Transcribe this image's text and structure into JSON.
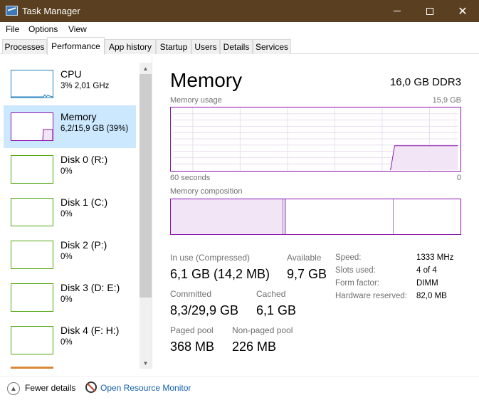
{
  "window": {
    "title": "Task Manager"
  },
  "menu": {
    "file": "File",
    "options": "Options",
    "view": "View"
  },
  "tabs": [
    "Processes",
    "Performance",
    "App history",
    "Startup",
    "Users",
    "Details",
    "Services"
  ],
  "left_items": [
    {
      "name": "CPU",
      "sub": "3%  2,01 GHz",
      "color": "#1e7fbf"
    },
    {
      "name": "Memory",
      "sub": "6,2/15,9 GB (39%)",
      "color": "#8b12ae"
    },
    {
      "name": "Disk 0 (R:)",
      "sub": "0%",
      "color": "#4da60c"
    },
    {
      "name": "Disk 1 (C:)",
      "sub": "0%",
      "color": "#4da60c"
    },
    {
      "name": "Disk 2 (P:)",
      "sub": "0%",
      "color": "#4da60c"
    },
    {
      "name": "Disk 3 (D: E:)",
      "sub": "0%",
      "color": "#4da60c"
    },
    {
      "name": "Disk 4 (F: H:)",
      "sub": "0%",
      "color": "#4da60c"
    }
  ],
  "memory": {
    "title": "Memory",
    "spec": "16,0 GB DDR3",
    "usage_label": "Memory usage",
    "usage_max": "15,9 GB",
    "time_label": "60 seconds",
    "time_zero": "0",
    "composition_label": "Memory composition",
    "in_use_label": "In use (Compressed)",
    "in_use_value": "6,1 GB (14,2 MB)",
    "available_label": "Available",
    "available_value": "9,7 GB",
    "committed_label": "Committed",
    "committed_value": "8,3/29,9 GB",
    "cached_label": "Cached",
    "cached_value": "6,1 GB",
    "paged_label": "Paged pool",
    "paged_value": "368 MB",
    "nonpaged_label": "Non-paged pool",
    "nonpaged_value": "226 MB",
    "speed_label": "Speed:",
    "speed_value": "1333 MHz",
    "slots_label": "Slots used:",
    "slots_value": "4 of 4",
    "form_label": "Form factor:",
    "form_value": "DIMM",
    "reserved_label": "Hardware reserved:",
    "reserved_value": "82,0 MB"
  },
  "footer": {
    "fewer": "Fewer details",
    "resource": "Open Resource Monitor"
  },
  "colors": {
    "memory": "#8b12ae",
    "disk": "#4da60c",
    "cpu": "#1e7fbf",
    "selected": "#cce8ff"
  }
}
